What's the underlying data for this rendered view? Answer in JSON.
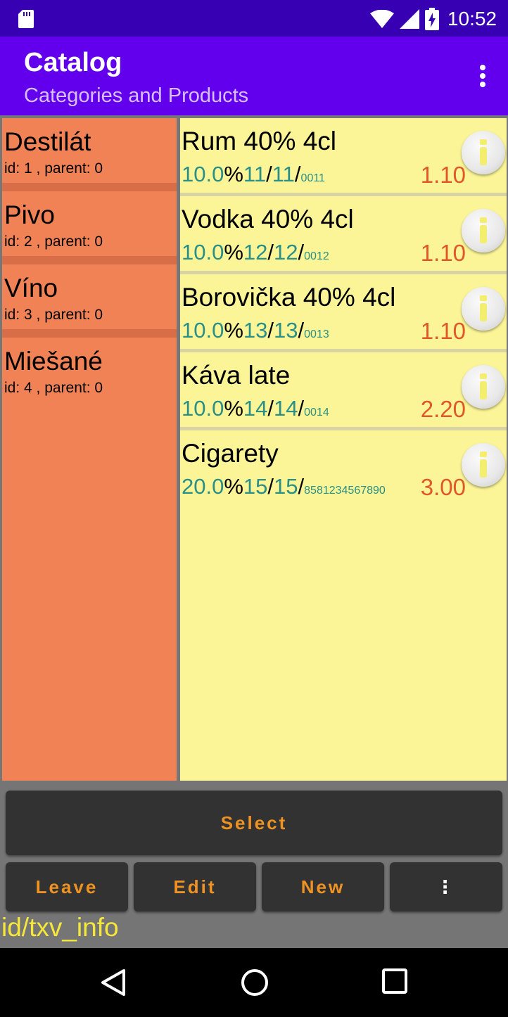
{
  "status_bar": {
    "time": "10:52",
    "icons": [
      "sd-card-icon",
      "wifi-icon",
      "signal-icon",
      "battery-charging-icon"
    ]
  },
  "app_bar": {
    "title": "Catalog",
    "subtitle": "Categories and Products",
    "menu_icon": "overflow-menu-icon"
  },
  "categories": [
    {
      "name": "Destilát",
      "meta": "id: 1 , parent: 0"
    },
    {
      "name": "Pivo",
      "meta": "id: 2 , parent: 0"
    },
    {
      "name": "Víno",
      "meta": "id: 3 , parent: 0"
    },
    {
      "name": "Miešané",
      "meta": "id: 4 , parent: 0"
    }
  ],
  "products": [
    {
      "name": "Rum 40% 4cl",
      "vat": "10.0",
      "pct": "%",
      "a": "11",
      "b": "11",
      "code": "0011",
      "price": "1.10"
    },
    {
      "name": "Vodka 40% 4cl",
      "vat": "10.0",
      "pct": "%",
      "a": "12",
      "b": "12",
      "code": "0012",
      "price": "1.10"
    },
    {
      "name": "Borovička 40% 4cl",
      "vat": "10.0",
      "pct": "%",
      "a": "13",
      "b": "13",
      "code": "0013",
      "price": "1.10"
    },
    {
      "name": "Káva late",
      "vat": "10.0",
      "pct": "%",
      "a": "14",
      "b": "14",
      "code": "0014",
      "price": "2.20"
    },
    {
      "name": "Cigarety",
      "vat": "20.0",
      "pct": "%",
      "a": "15",
      "b": "15",
      "code": "8581234567890",
      "price": "3.00"
    }
  ],
  "actions": {
    "select": "Select",
    "leave": "Leave",
    "edit": "Edit",
    "new": "New",
    "more": "⋮"
  },
  "info_text": "id/txv_info",
  "colors": {
    "status_bar": "#3700b3",
    "app_bar": "#6200ee",
    "category_bg": "#f08255",
    "product_bg": "#fbf597",
    "meta_teal": "#2a8f86",
    "price_orange": "#e2572a",
    "button_text": "#ee9223",
    "info_yellow": "#f5e83a"
  }
}
